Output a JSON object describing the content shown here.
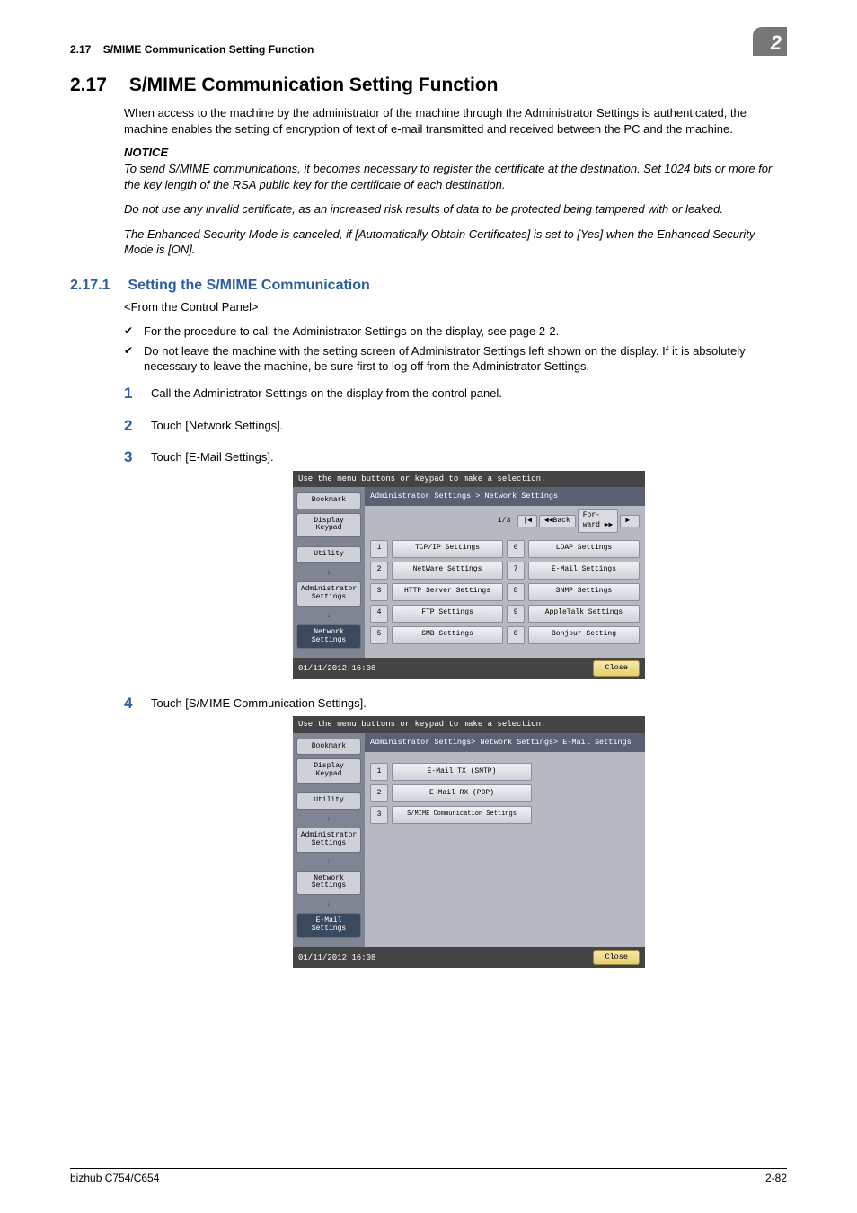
{
  "header": {
    "section_no": "2.17",
    "section_name": "S/MIME Communication Setting Function",
    "chapter_no": "2"
  },
  "title": {
    "no": "2.17",
    "text": "S/MIME Communication Setting Function"
  },
  "intro": "When access to the machine by the administrator of the machine through the Administrator Settings is authenticated, the machine enables the setting of encryption of text of e-mail transmitted and received between the PC and the machine.",
  "notice_label": "NOTICE",
  "notices": [
    "To send S/MIME communications, it becomes necessary to register the certificate at the destination. Set 1024 bits or more for the key length of the RSA public key for the certificate of each destination.",
    "Do not use any invalid certificate, as an increased risk results of data to be protected being tampered with or leaked.",
    "The Enhanced Security Mode is canceled, if [Automatically Obtain Certificates] is set to [Yes] when the Enhanced Security Mode is [ON]."
  ],
  "subsection": {
    "no": "2.17.1",
    "text": "Setting the S/MIME Communication"
  },
  "from_panel": "<From the Control Panel>",
  "checks": [
    "For the procedure to call the Administrator Settings on the display, see page 2-2.",
    "Do not leave the machine with the setting screen of Administrator Settings left shown on the display. If it is absolutely necessary to leave the machine, be sure first to log off from the Administrator Settings."
  ],
  "steps": [
    "Call the Administrator Settings on the display from the control panel.",
    "Touch [Network Settings].",
    "Touch [E-Mail Settings].",
    "Touch [S/MIME Communication Settings]."
  ],
  "screenshot1": {
    "instruction": "Use the menu buttons or keypad to make a selection.",
    "side": {
      "bookmark": "Bookmark",
      "keypad": "Display Keypad",
      "utility": "Utility",
      "admin": "Administrator Settings",
      "network": "Network Settings"
    },
    "crumb": "Administrator Settings > Network Settings",
    "page": "1/3",
    "back": "◀◀Back",
    "forw": "For-\nward ▶▶",
    "items": [
      {
        "n": "1",
        "label": "TCP/IP Settings"
      },
      {
        "n": "2",
        "label": "NetWare Settings"
      },
      {
        "n": "3",
        "label": "HTTP Server Settings"
      },
      {
        "n": "4",
        "label": "FTP Settings"
      },
      {
        "n": "5",
        "label": "SMB Settings"
      },
      {
        "n": "6",
        "label": "LDAP Settings"
      },
      {
        "n": "7",
        "label": "E-Mail Settings"
      },
      {
        "n": "8",
        "label": "SNMP Settings"
      },
      {
        "n": "9",
        "label": "AppleTalk Settings"
      },
      {
        "n": "0",
        "label": "Bonjour Setting"
      }
    ],
    "datetime": "01/11/2012   16:08",
    "close": "Close"
  },
  "screenshot2": {
    "instruction": "Use the menu buttons or keypad to make a selection.",
    "side": {
      "bookmark": "Bookmark",
      "keypad": "Display Keypad",
      "utility": "Utility",
      "admin": "Administrator Settings",
      "network": "Network Settings",
      "email": "E-Mail Settings"
    },
    "crumb": "Administrator Settings> Network Settings> E-Mail Settings",
    "items": [
      {
        "n": "1",
        "label": "E-Mail TX (SMTP)"
      },
      {
        "n": "2",
        "label": "E-Mail RX (POP)"
      },
      {
        "n": "3",
        "label": "S/MIME Communication Settings"
      }
    ],
    "datetime": "01/11/2012   16:08",
    "close": "Close"
  },
  "footer": {
    "left": "bizhub C754/C654",
    "right": "2-82"
  }
}
